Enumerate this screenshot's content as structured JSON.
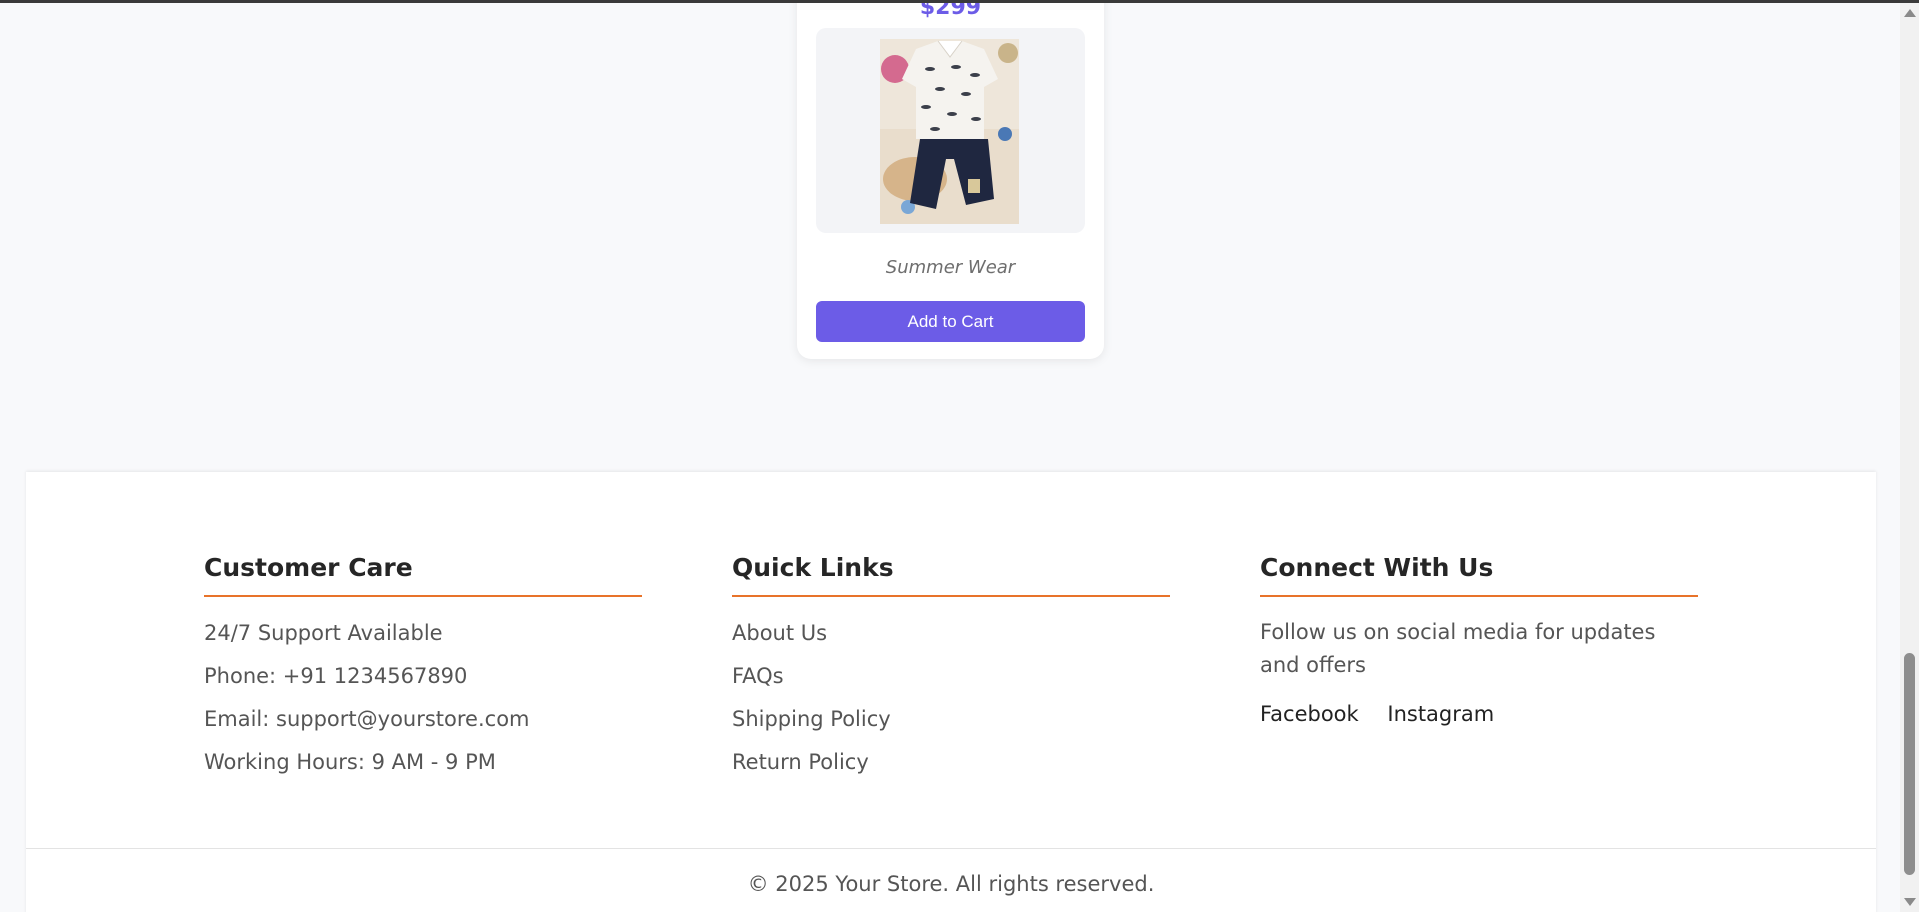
{
  "product": {
    "price": "$299",
    "name": "Summer Wear",
    "add_to_cart": "Add to Cart",
    "image_alt": "Kids summer outfit: white printed shirt with navy shorts"
  },
  "footer": {
    "customer_care": {
      "title": "Customer Care",
      "items": [
        "24/7 Support Available",
        "Phone: +91 1234567890",
        "Email: support@yourstore.com",
        "Working Hours: 9 AM - 9 PM"
      ]
    },
    "quick_links": {
      "title": "Quick Links",
      "items": [
        "About Us",
        "FAQs",
        "Shipping Policy",
        "Return Policy"
      ]
    },
    "connect": {
      "title": "Connect With Us",
      "text": "Follow us on social media for updates and offers",
      "links": [
        "Facebook",
        "Instagram"
      ]
    },
    "copyright": "© 2025 Your Store. All rights reserved."
  },
  "colors": {
    "accent": "#6c5ce7",
    "divider": "#e8732a",
    "background": "#f8f9fb"
  },
  "icons": [
    "scroll-up-arrow-icon",
    "scroll-down-arrow-icon"
  ]
}
